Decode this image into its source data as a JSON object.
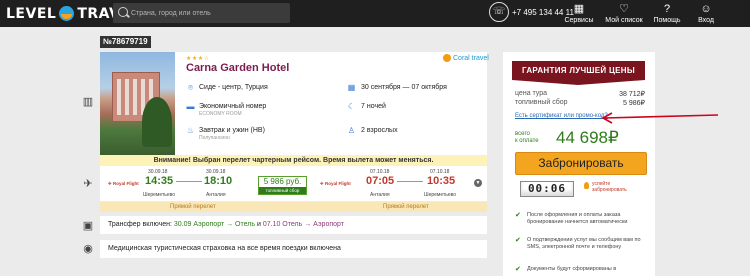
{
  "header": {
    "logo_text_left": "LEVEL",
    "logo_text_right": "TRAVEL",
    "search_placeholder": "Страна, город или отель",
    "phone": "+7 495 134 44 11",
    "nav": [
      {
        "label": "Сервисы",
        "icon": "grid-icon"
      },
      {
        "label": "Мой список",
        "icon": "heart-icon"
      },
      {
        "label": "Помощь",
        "icon": "help-icon"
      },
      {
        "label": "Вход",
        "icon": "user-icon"
      }
    ]
  },
  "order": {
    "id": "№78679719"
  },
  "hotel": {
    "stars": "★★★☆",
    "name": "Carna Garden Hotel",
    "brand": "Coral travel",
    "location": "Сиде - центр, Турция",
    "dates": "30 сентября — 07 октября",
    "room": "Экономичный номер",
    "room_sub": "ECONOMY ROOM",
    "nights": "7 ночей",
    "meals": "Завтрак и ужин (HB)",
    "meals_sub": "Полупансион",
    "guests": "2 взрослых"
  },
  "flight": {
    "warning": "Внимание! Выбран перелет чартерным рейсом. Время вылета может меняться.",
    "out_airline": "Royal Flight",
    "out_dep_date": "30.09.18",
    "out_dep_time": "14:35",
    "out_dep_city": "Шереметьево",
    "out_arr_date": "30.09.18",
    "out_arr_time": "18:10",
    "out_arr_city": "Анталия",
    "price": "5 986 руб.",
    "price_label": "топливный сбор",
    "ret_airline": "Royal Flight",
    "ret_dep_date": "07.10.18",
    "ret_dep_time": "07:05",
    "ret_dep_city": "Анталия",
    "ret_arr_date": "07.10.18",
    "ret_arr_time": "10:35",
    "ret_arr_city": "Шереметьево",
    "direct_out": "Прямой перелет",
    "direct_ret": "Прямой перелет"
  },
  "transfer": {
    "label": "Трансфер включен:",
    "out": "30.09 Аэропорт → Отель",
    "sep": "и",
    "ret": "07.10 Отель → Аэропорт"
  },
  "insurance": {
    "text": "Медицинская туристическая страховка на все время поездки включена"
  },
  "sidebar": {
    "guarantee": "ГАРАНТИЯ ЛУЧШЕЙ ЦЕНЫ",
    "tour_price_label": "цена тура",
    "tour_price": "38 712₽",
    "fuel_label": "топливный сбор",
    "fuel_price": "5 986₽",
    "promo": "Есть сертификат или промо-код?",
    "total_label_1": "всего",
    "total_label_2": "к оплате",
    "total": "44 698₽",
    "book_button": "Забронировать",
    "counter": "00:06",
    "counter_note_1": "успейте",
    "counter_note_2": "забронировать",
    "checks": [
      "После оформления и оплаты заказа бронирование начнется автоматически",
      "О подтверждении услуг мы сообщим вам по SMS, электронной почте и телефону",
      "Документы будут сформированы в"
    ]
  }
}
